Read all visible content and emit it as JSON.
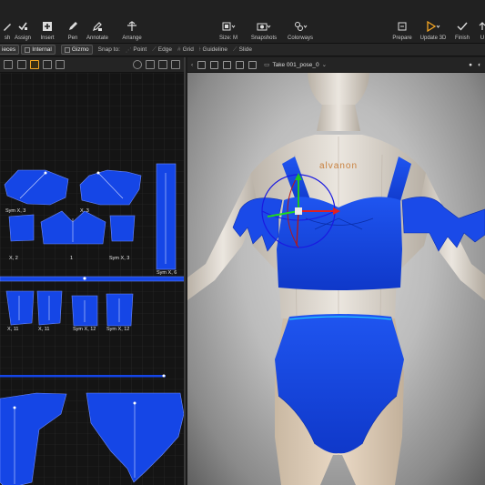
{
  "toolbar": {
    "left_buttons": [
      {
        "label": "sh",
        "icon": "brush-icon"
      },
      {
        "label": "Assign",
        "icon": "assign-icon"
      },
      {
        "label": "Insert",
        "icon": "insert-icon"
      },
      {
        "label": "Pen",
        "icon": "pen-icon"
      },
      {
        "label": "Annotate",
        "icon": "annotate-icon"
      },
      {
        "label": "Arrange",
        "icon": "arrange-icon"
      }
    ],
    "center_buttons": [
      {
        "label": "Size: M",
        "icon": "size-icon"
      },
      {
        "label": "Snapshots",
        "icon": "snapshots-icon"
      },
      {
        "label": "Colorways",
        "icon": "colorways-icon"
      }
    ],
    "right_buttons": [
      {
        "label": "Prepare",
        "icon": "prepare-icon"
      },
      {
        "label": "Update 3D",
        "icon": "play-icon"
      },
      {
        "label": "Finish",
        "icon": "checkmark-icon"
      },
      {
        "label": "U",
        "icon": "upload-icon"
      }
    ]
  },
  "subbar": {
    "pieces_label": "ieces",
    "internal_label": "Internal",
    "gizmo_label": "Gizmo",
    "snap_to_label": "Snap to:",
    "snap_options": [
      "Point",
      "Edge",
      "Grid",
      "Guideline",
      "Slide"
    ]
  },
  "view3d": {
    "take_label": "Take 001_pose_0"
  },
  "pieces": {
    "top_left": "Sym X, 3",
    "top_right": "X, 3",
    "row2_a": "X, 2",
    "row2_b": "1",
    "row2_c": "Sym X, 3",
    "strap": "Sym X, 6",
    "sleeve_a": "X, 11",
    "sleeve_b": "X, 11",
    "sleeve_c": "Sym X, 12",
    "sleeve_d": "Sym X, 12"
  },
  "avatar": {
    "logo": "alvanon"
  },
  "colors": {
    "garment": "#1546e6",
    "grid_bg": "#141414",
    "accent": "#f5a623"
  }
}
